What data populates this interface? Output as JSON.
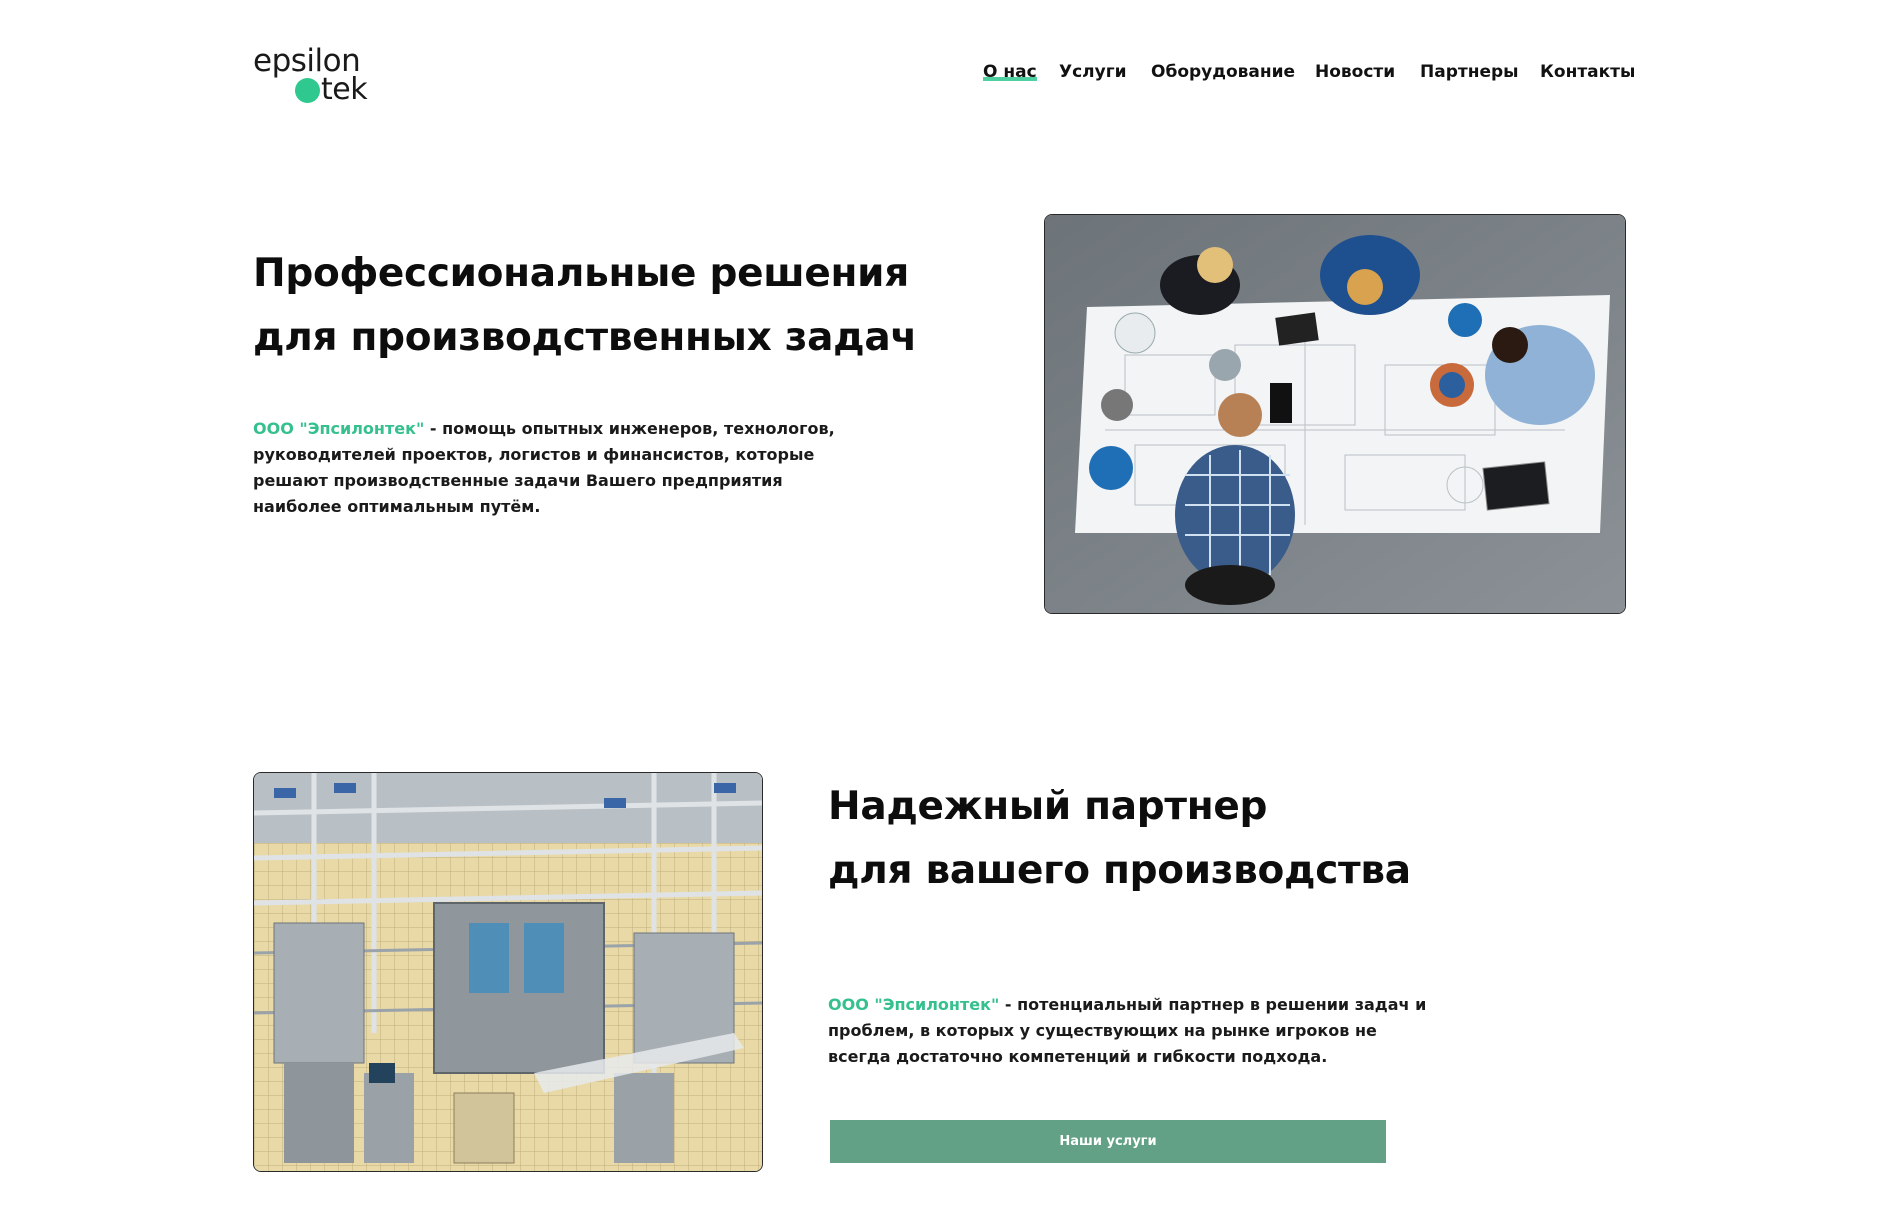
{
  "header": {
    "logo_top": "epsilon",
    "logo_bottom": "tek",
    "nav": [
      {
        "label": "О нас",
        "active": true
      },
      {
        "label": "Услуги",
        "active": false
      },
      {
        "label": "Оборудование",
        "active": false
      },
      {
        "label": "Новости",
        "active": false
      },
      {
        "label": "Партнеры",
        "active": false
      },
      {
        "label": "Контакты",
        "active": false
      }
    ]
  },
  "hero": {
    "title_line1": "Профессиональные решения",
    "title_line2": "для производственных задач",
    "company": "ООО \"Эпсилонтек\"",
    "text": " - помощь опытных инженеров, технологов, руководителей проектов, логистов и финансистов, которые решают производственные задачи Вашего предприятия наиболее оптимальным путём."
  },
  "partner": {
    "title_line1": "Надежный партнер",
    "title_line2": "для вашего производства",
    "company": "ООО \"Эпсилонтек\"",
    "text": " - потенциальный партнер в решении задач и проблем, в которых у существующих на рынке игроков не всегда достаточно компетенций и гибкости подхода.",
    "button_label": "Наши услуги"
  },
  "colors": {
    "accent": "#2fc88f",
    "company_text": "#35c08e",
    "button_bg": "#62a185"
  }
}
